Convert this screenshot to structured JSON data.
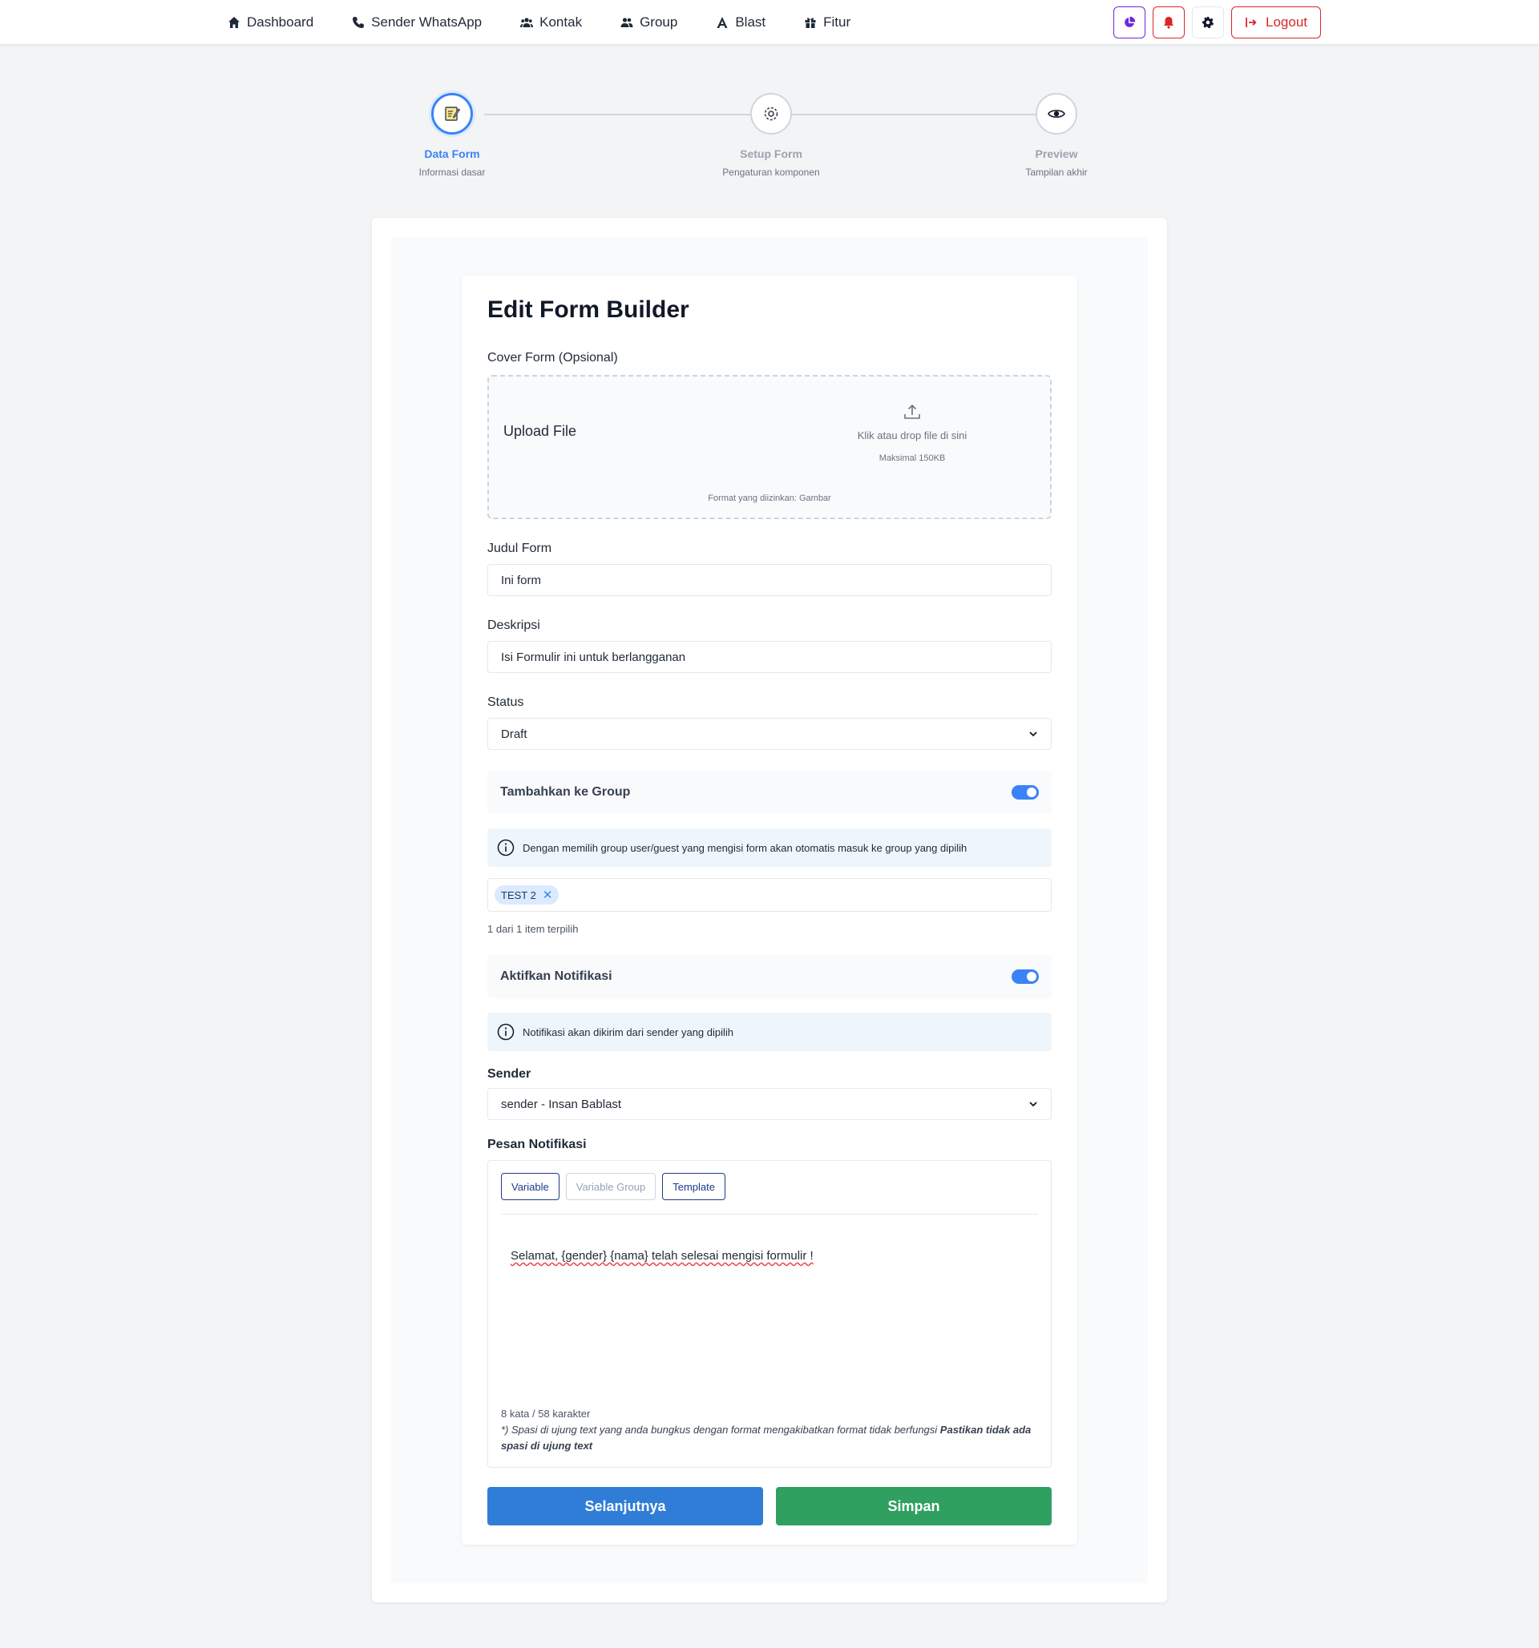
{
  "nav": {
    "links": [
      {
        "label": "Dashboard",
        "icon": "home-icon"
      },
      {
        "label": "Sender WhatsApp",
        "icon": "phone-icon"
      },
      {
        "label": "Kontak",
        "icon": "contacts-icon"
      },
      {
        "label": "Group",
        "icon": "group-icon"
      },
      {
        "label": "Blast",
        "icon": "blast-icon"
      },
      {
        "label": "Fitur",
        "icon": "gift-icon"
      }
    ],
    "logout_label": "Logout"
  },
  "stepper": {
    "steps": [
      {
        "title": "Data Form",
        "subtitle": "Informasi dasar",
        "icon": "edit-note-icon",
        "active": true
      },
      {
        "title": "Setup Form",
        "subtitle": "Pengaturan komponen",
        "icon": "gear-icon",
        "active": false
      },
      {
        "title": "Preview",
        "subtitle": "Tampilan akhir",
        "icon": "eye-icon",
        "active": false
      }
    ]
  },
  "form": {
    "title": "Edit Form Builder",
    "cover_label": "Cover Form (Opsional)",
    "upload": {
      "title": "Upload File",
      "hint": "Klik atau drop file di sini",
      "max": "Maksimal 150KB",
      "format": "Format yang diizinkan: Gambar"
    },
    "judul_label": "Judul Form",
    "judul_value": "Ini form",
    "deskripsi_label": "Deskripsi",
    "deskripsi_value": "Isi Formulir ini untuk berlangganan",
    "status_label": "Status",
    "status_value": "Draft",
    "group_toggle_label": "Tambahkan ke Group",
    "group_toggle_on": true,
    "group_info": "Dengan memilih group user/guest yang mengisi form akan otomatis masuk ke group yang dipilih",
    "group_tags": [
      "TEST 2"
    ],
    "group_count": "1 dari 1 item terpilih",
    "notif_toggle_label": "Aktifkan Notifikasi",
    "notif_toggle_on": true,
    "notif_info": "Notifikasi akan dikirim dari sender yang dipilih",
    "sender_label": "Sender",
    "sender_value": "sender - Insan Bablast",
    "pesan_label": "Pesan Notifikasi",
    "editor": {
      "tabs": [
        "Variable",
        "Variable Group",
        "Template"
      ],
      "text": "Selamat, {gender} {nama} telah selesai mengisi formulir !",
      "count": "8 kata / 58 karakter",
      "note_prefix": "*) Spasi di ujung text yang anda bungkus dengan format mengakibatkan format tidak berfungsi ",
      "note_bold": "Pastikan tidak ada spasi di ujung text"
    },
    "next_label": "Selanjutnya",
    "save_label": "Simpan"
  },
  "colors": {
    "primary": "#2f7dd6",
    "success": "#30a060",
    "danger": "#dc2626",
    "accent_purple": "#6d28d9",
    "info_bg": "#eef6fc"
  }
}
